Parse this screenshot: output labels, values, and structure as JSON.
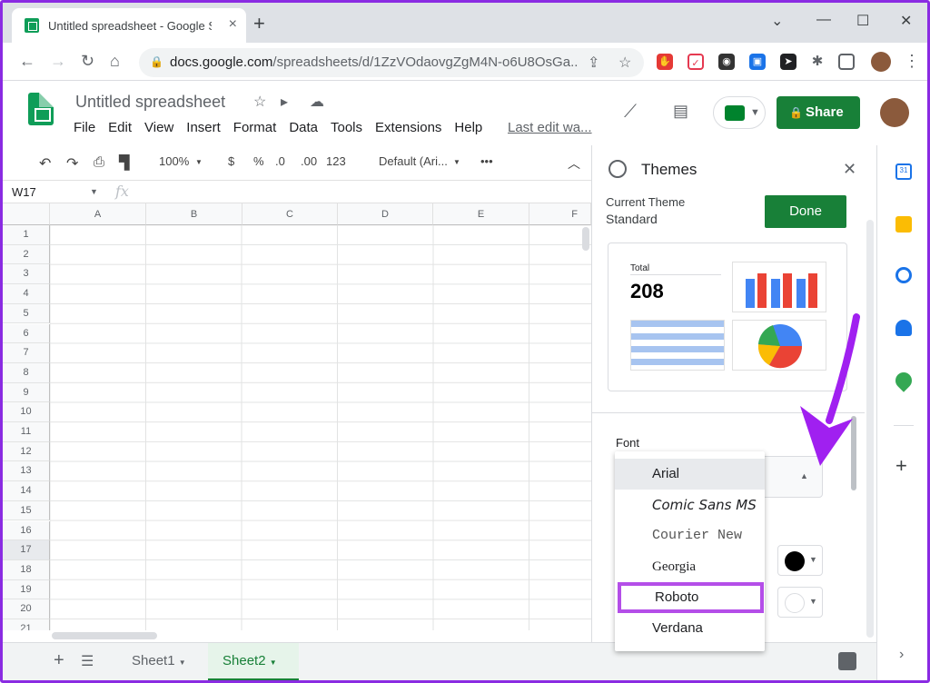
{
  "browser": {
    "tab_title": "Untitled spreadsheet - Google Sheets",
    "new_tab": "+",
    "url_domain": "docs.google.com",
    "url_path": "/spreadsheets/d/1ZzVOdaovgZgM4N-o6U8OsGa..."
  },
  "sheet": {
    "title": "Untitled spreadsheet",
    "menus": [
      "File",
      "Edit",
      "View",
      "Insert",
      "Format",
      "Data",
      "Tools",
      "Extensions",
      "Help"
    ],
    "last_edit": "Last edit wa...",
    "share_label": "Share"
  },
  "format_bar": {
    "zoom": "100%",
    "currency": "$",
    "percent": "%",
    "dec_decrease": ".0",
    "dec_increase": ".00",
    "number_format": "123",
    "font": "Default (Ari...",
    "more": "•••"
  },
  "formula_bar": {
    "name_box": "W17",
    "fx": "fx"
  },
  "grid": {
    "columns": [
      "A",
      "B",
      "C",
      "D",
      "E",
      "F"
    ],
    "rows": [
      "1",
      "2",
      "3",
      "4",
      "5",
      "6",
      "7",
      "8",
      "9",
      "10",
      "11",
      "12",
      "13",
      "14",
      "15",
      "16",
      "17",
      "18",
      "19",
      "20",
      "21"
    ],
    "selected_row": "17"
  },
  "sheet_tabs": {
    "add": "+",
    "tabs": [
      {
        "label": "Sheet1",
        "active": false
      },
      {
        "label": "Sheet2",
        "active": true
      }
    ]
  },
  "themes_panel": {
    "title": "Themes",
    "current_theme_label": "Current Theme",
    "current_theme_name": "Standard",
    "done_label": "Done",
    "preview": {
      "total_label": "Total",
      "total_value": "208"
    },
    "font_label": "Font",
    "text_color": "#000000",
    "bg_color": "#ffffff"
  },
  "font_dropdown": {
    "options": [
      "Arial",
      "Comic Sans MS",
      "Courier New",
      "Georgia",
      "Roboto",
      "Verdana"
    ],
    "hovered": "Arial",
    "highlighted": "Roboto",
    "highlight_color": "#b44ee8"
  },
  "colors": {
    "accent_green": "#188038",
    "annotation_purple": "#a020f0",
    "frame_border": "#8a2be2"
  }
}
